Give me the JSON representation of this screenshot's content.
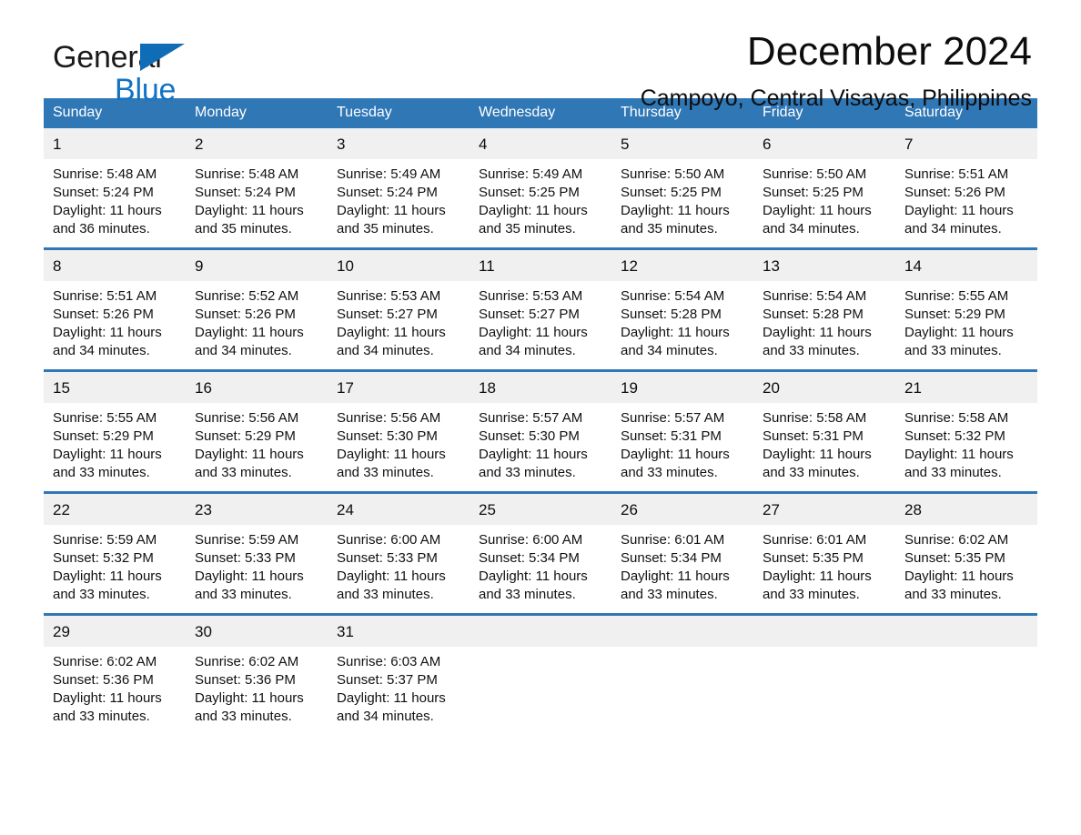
{
  "brand": {
    "name_top": "General",
    "name_bottom": "Blue",
    "flag_icon": "triangle-flag-icon",
    "accent_color": "#1273c4"
  },
  "header": {
    "title": "December 2024",
    "subtitle": "Campoyo, Central Visayas, Philippines"
  },
  "calendar": {
    "header_bg": "#3077b6",
    "daynum_bg": "#f0f0f0",
    "row_border_color": "#2f77b6",
    "weekdays": [
      "Sunday",
      "Monday",
      "Tuesday",
      "Wednesday",
      "Thursday",
      "Friday",
      "Saturday"
    ],
    "weeks": [
      [
        {
          "day": "1",
          "sunrise": "Sunrise: 5:48 AM",
          "sunset": "Sunset: 5:24 PM",
          "daylight": "Daylight: 11 hours and 36 minutes."
        },
        {
          "day": "2",
          "sunrise": "Sunrise: 5:48 AM",
          "sunset": "Sunset: 5:24 PM",
          "daylight": "Daylight: 11 hours and 35 minutes."
        },
        {
          "day": "3",
          "sunrise": "Sunrise: 5:49 AM",
          "sunset": "Sunset: 5:24 PM",
          "daylight": "Daylight: 11 hours and 35 minutes."
        },
        {
          "day": "4",
          "sunrise": "Sunrise: 5:49 AM",
          "sunset": "Sunset: 5:25 PM",
          "daylight": "Daylight: 11 hours and 35 minutes."
        },
        {
          "day": "5",
          "sunrise": "Sunrise: 5:50 AM",
          "sunset": "Sunset: 5:25 PM",
          "daylight": "Daylight: 11 hours and 35 minutes."
        },
        {
          "day": "6",
          "sunrise": "Sunrise: 5:50 AM",
          "sunset": "Sunset: 5:25 PM",
          "daylight": "Daylight: 11 hours and 34 minutes."
        },
        {
          "day": "7",
          "sunrise": "Sunrise: 5:51 AM",
          "sunset": "Sunset: 5:26 PM",
          "daylight": "Daylight: 11 hours and 34 minutes."
        }
      ],
      [
        {
          "day": "8",
          "sunrise": "Sunrise: 5:51 AM",
          "sunset": "Sunset: 5:26 PM",
          "daylight": "Daylight: 11 hours and 34 minutes."
        },
        {
          "day": "9",
          "sunrise": "Sunrise: 5:52 AM",
          "sunset": "Sunset: 5:26 PM",
          "daylight": "Daylight: 11 hours and 34 minutes."
        },
        {
          "day": "10",
          "sunrise": "Sunrise: 5:53 AM",
          "sunset": "Sunset: 5:27 PM",
          "daylight": "Daylight: 11 hours and 34 minutes."
        },
        {
          "day": "11",
          "sunrise": "Sunrise: 5:53 AM",
          "sunset": "Sunset: 5:27 PM",
          "daylight": "Daylight: 11 hours and 34 minutes."
        },
        {
          "day": "12",
          "sunrise": "Sunrise: 5:54 AM",
          "sunset": "Sunset: 5:28 PM",
          "daylight": "Daylight: 11 hours and 34 minutes."
        },
        {
          "day": "13",
          "sunrise": "Sunrise: 5:54 AM",
          "sunset": "Sunset: 5:28 PM",
          "daylight": "Daylight: 11 hours and 33 minutes."
        },
        {
          "day": "14",
          "sunrise": "Sunrise: 5:55 AM",
          "sunset": "Sunset: 5:29 PM",
          "daylight": "Daylight: 11 hours and 33 minutes."
        }
      ],
      [
        {
          "day": "15",
          "sunrise": "Sunrise: 5:55 AM",
          "sunset": "Sunset: 5:29 PM",
          "daylight": "Daylight: 11 hours and 33 minutes."
        },
        {
          "day": "16",
          "sunrise": "Sunrise: 5:56 AM",
          "sunset": "Sunset: 5:29 PM",
          "daylight": "Daylight: 11 hours and 33 minutes."
        },
        {
          "day": "17",
          "sunrise": "Sunrise: 5:56 AM",
          "sunset": "Sunset: 5:30 PM",
          "daylight": "Daylight: 11 hours and 33 minutes."
        },
        {
          "day": "18",
          "sunrise": "Sunrise: 5:57 AM",
          "sunset": "Sunset: 5:30 PM",
          "daylight": "Daylight: 11 hours and 33 minutes."
        },
        {
          "day": "19",
          "sunrise": "Sunrise: 5:57 AM",
          "sunset": "Sunset: 5:31 PM",
          "daylight": "Daylight: 11 hours and 33 minutes."
        },
        {
          "day": "20",
          "sunrise": "Sunrise: 5:58 AM",
          "sunset": "Sunset: 5:31 PM",
          "daylight": "Daylight: 11 hours and 33 minutes."
        },
        {
          "day": "21",
          "sunrise": "Sunrise: 5:58 AM",
          "sunset": "Sunset: 5:32 PM",
          "daylight": "Daylight: 11 hours and 33 minutes."
        }
      ],
      [
        {
          "day": "22",
          "sunrise": "Sunrise: 5:59 AM",
          "sunset": "Sunset: 5:32 PM",
          "daylight": "Daylight: 11 hours and 33 minutes."
        },
        {
          "day": "23",
          "sunrise": "Sunrise: 5:59 AM",
          "sunset": "Sunset: 5:33 PM",
          "daylight": "Daylight: 11 hours and 33 minutes."
        },
        {
          "day": "24",
          "sunrise": "Sunrise: 6:00 AM",
          "sunset": "Sunset: 5:33 PM",
          "daylight": "Daylight: 11 hours and 33 minutes."
        },
        {
          "day": "25",
          "sunrise": "Sunrise: 6:00 AM",
          "sunset": "Sunset: 5:34 PM",
          "daylight": "Daylight: 11 hours and 33 minutes."
        },
        {
          "day": "26",
          "sunrise": "Sunrise: 6:01 AM",
          "sunset": "Sunset: 5:34 PM",
          "daylight": "Daylight: 11 hours and 33 minutes."
        },
        {
          "day": "27",
          "sunrise": "Sunrise: 6:01 AM",
          "sunset": "Sunset: 5:35 PM",
          "daylight": "Daylight: 11 hours and 33 minutes."
        },
        {
          "day": "28",
          "sunrise": "Sunrise: 6:02 AM",
          "sunset": "Sunset: 5:35 PM",
          "daylight": "Daylight: 11 hours and 33 minutes."
        }
      ],
      [
        {
          "day": "29",
          "sunrise": "Sunrise: 6:02 AM",
          "sunset": "Sunset: 5:36 PM",
          "daylight": "Daylight: 11 hours and 33 minutes."
        },
        {
          "day": "30",
          "sunrise": "Sunrise: 6:02 AM",
          "sunset": "Sunset: 5:36 PM",
          "daylight": "Daylight: 11 hours and 33 minutes."
        },
        {
          "day": "31",
          "sunrise": "Sunrise: 6:03 AM",
          "sunset": "Sunset: 5:37 PM",
          "daylight": "Daylight: 11 hours and 34 minutes."
        },
        {
          "day": "",
          "sunrise": "",
          "sunset": "",
          "daylight": ""
        },
        {
          "day": "",
          "sunrise": "",
          "sunset": "",
          "daylight": ""
        },
        {
          "day": "",
          "sunrise": "",
          "sunset": "",
          "daylight": ""
        },
        {
          "day": "",
          "sunrise": "",
          "sunset": "",
          "daylight": ""
        }
      ]
    ]
  }
}
